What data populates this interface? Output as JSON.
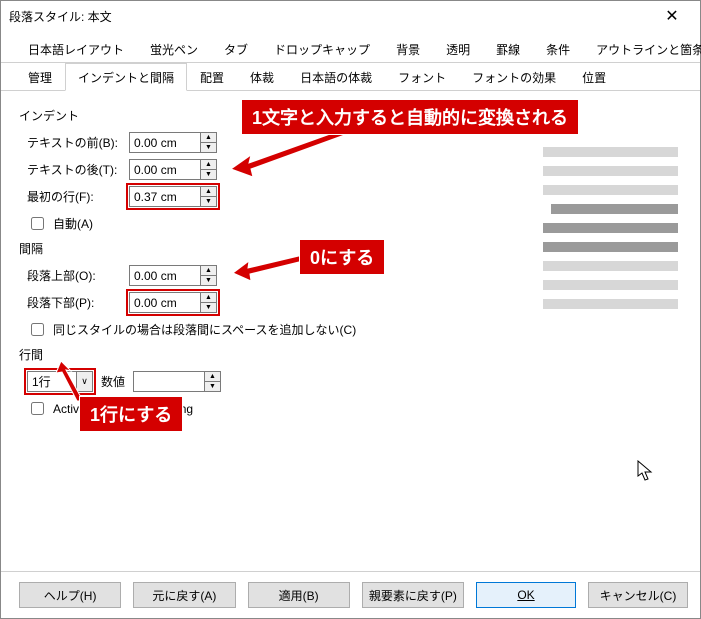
{
  "window": {
    "title": "段落スタイル: 本文"
  },
  "tabs_row1": [
    "日本語レイアウト",
    "蛍光ペン",
    "タブ",
    "ドロップキャップ",
    "背景",
    "透明",
    "罫線",
    "条件",
    "アウトラインと箇条書き"
  ],
  "tabs_row2": [
    "管理",
    "インデントと間隔",
    "配置",
    "体裁",
    "日本語の体裁",
    "フォント",
    "フォントの効果",
    "位置"
  ],
  "active_tab": "インデントと間隔",
  "indent": {
    "head": "インデント",
    "before_label": "テキストの前(B):",
    "before_value": "0.00 cm",
    "after_label": "テキストの後(T):",
    "after_value": "0.00 cm",
    "first_label": "最初の行(F):",
    "first_value": "0.37 cm",
    "auto_label": "自動(A)"
  },
  "spacing": {
    "head": "間隔",
    "above_label": "段落上部(O):",
    "above_value": "0.00 cm",
    "below_label": "段落下部(P):",
    "below_value": "0.00 cm",
    "nospace_label": "同じスタイルの場合は段落間にスペースを追加しない(C)"
  },
  "leading": {
    "head": "行間",
    "value_selected": "1行",
    "numval_label": "数値",
    "numval_value": "",
    "pagespacing_label": "Activate page line-spacing"
  },
  "callouts": {
    "first_line": "1文字と入力すると自動的に変換される",
    "zero": "0にする",
    "oneline": "1行にする"
  },
  "buttons": {
    "help": "ヘルプ(H)",
    "reset": "元に戻す(A)",
    "apply": "適用(B)",
    "parent": "親要素に戻す(P)",
    "ok": "OK",
    "cancel": "キャンセル(C)"
  },
  "icons": {
    "close": "✕",
    "up": "▲",
    "down": "▼",
    "dd": "∨"
  }
}
